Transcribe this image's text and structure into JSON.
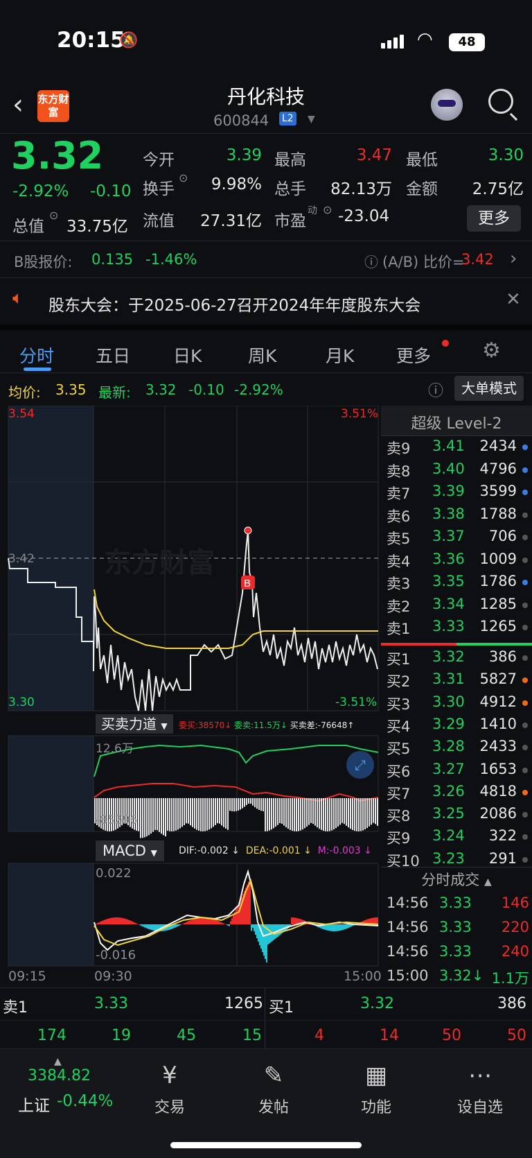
{
  "status_bar": {
    "time": "20:15",
    "battery": "48"
  },
  "header": {
    "logo_text": "东方财富",
    "stock_name": "丹化科技",
    "stock_code": "600844",
    "badge": "L2"
  },
  "quote": {
    "price": "3.32",
    "change_pct": "-2.92%",
    "change": "-0.10",
    "open_label": "今开",
    "open": "3.39",
    "high_label": "最高",
    "high": "3.47",
    "low_label": "最低",
    "low": "3.30",
    "turnover_label": "换手",
    "turnover": "9.98%",
    "volume_label": "总手",
    "volume": "82.13万",
    "amount_label": "金额",
    "amount": "2.75亿",
    "mktcap_label": "总值",
    "mktcap": "33.75亿",
    "float_label": "流值",
    "float": "27.31亿",
    "pe_label": "市盈",
    "pe_sup": "动",
    "pe": "-23.04",
    "more_label": "更多"
  },
  "bshare": {
    "label": "B股报价:",
    "price": "0.135",
    "pct": "-1.46%",
    "ratio_label": "(A/B) 比价=",
    "ratio": "3.42"
  },
  "notice": {
    "text": "股东大会：于2025-06-27召开2024年年度股东大会"
  },
  "tabs": [
    "分时",
    "五日",
    "日K",
    "周K",
    "月K",
    "更多"
  ],
  "avg": {
    "avg_label": "均价:",
    "avg": "3.35",
    "last_label": "最新:",
    "last": "3.32",
    "chg": "-0.10",
    "pct": "-2.92%",
    "mode_btn": "大单模式"
  },
  "chart": {
    "price_top": "3.54",
    "price_mid": "3.42",
    "price_bottom": "3.30",
    "pct_top": "3.51%",
    "pct_bottom": "-3.51%",
    "watermark": "东方财富",
    "b_marker": "B",
    "indicator1_label": "买卖力道",
    "weimai": "委买:38570",
    "weimai_arrow": "↓",
    "weimai2": "委卖:11.5万",
    "weimai2_arrow": "↓",
    "maimaicha": "买卖差:-76648",
    "maimaicha_arrow": "↑",
    "ind1_top": "12.6万",
    "ind1_bottom": "-85296",
    "indicator2_label": "MACD",
    "dif": "DIF:-0.002",
    "dif_arrow": "↓",
    "dea": "DEA:-0.001",
    "dea_arrow": "↓",
    "m": "M:-0.003",
    "m_arrow": "↓",
    "macd_top": "0.022",
    "macd_bottom": "-0.016",
    "time_start": "09:15",
    "time_open": "09:30",
    "time_end": "15:00"
  },
  "level2": {
    "title": "超级 Level-2",
    "sell": [
      {
        "label": "卖9",
        "price": "3.41",
        "vol": "2434",
        "dot": "#3b7fe0"
      },
      {
        "label": "卖8",
        "price": "3.40",
        "vol": "4796",
        "dot": "#3b7fe0"
      },
      {
        "label": "卖7",
        "price": "3.39",
        "vol": "3599",
        "dot": "#3b7fe0"
      },
      {
        "label": "卖6",
        "price": "3.38",
        "vol": "1788",
        "dot": "#555"
      },
      {
        "label": "卖5",
        "price": "3.37",
        "vol": "706",
        "dot": "#555"
      },
      {
        "label": "卖4",
        "price": "3.36",
        "vol": "1009",
        "dot": "#555"
      },
      {
        "label": "卖3",
        "price": "3.35",
        "vol": "1786",
        "dot": "#3b7fe0"
      },
      {
        "label": "卖2",
        "price": "3.34",
        "vol": "1285",
        "dot": "#555"
      },
      {
        "label": "卖1",
        "price": "3.33",
        "vol": "1265",
        "dot": "#555"
      }
    ],
    "buy": [
      {
        "label": "买1",
        "price": "3.32",
        "vol": "386",
        "dot": "#555"
      },
      {
        "label": "买2",
        "price": "3.31",
        "vol": "5827",
        "dot": "#f06a1c"
      },
      {
        "label": "买3",
        "price": "3.30",
        "vol": "4912",
        "dot": "#f06a1c"
      },
      {
        "label": "买4",
        "price": "3.29",
        "vol": "1410",
        "dot": "#555"
      },
      {
        "label": "买5",
        "price": "3.28",
        "vol": "2433",
        "dot": "#555"
      },
      {
        "label": "买6",
        "price": "3.27",
        "vol": "1653",
        "dot": "#555"
      },
      {
        "label": "买7",
        "price": "3.26",
        "vol": "4818",
        "dot": "#f06a1c"
      },
      {
        "label": "买8",
        "price": "3.25",
        "vol": "2086",
        "dot": "#555"
      },
      {
        "label": "买9",
        "price": "3.24",
        "vol": "322",
        "dot": "#555"
      },
      {
        "label": "买10",
        "price": "3.23",
        "vol": "291",
        "dot": "#555"
      }
    ],
    "trades_title": "分时成交",
    "trades": [
      {
        "time": "14:56",
        "price": "3.33",
        "vol": "146",
        "vcolor": "red"
      },
      {
        "time": "14:56",
        "price": "3.33",
        "vol": "220",
        "vcolor": "red"
      },
      {
        "time": "14:56",
        "price": "3.33",
        "vol": "240",
        "vcolor": "red"
      },
      {
        "time": "15:00",
        "price": "3.32↓",
        "vol": "1.1万",
        "vcolor": "green"
      }
    ]
  },
  "bottom_ob": {
    "sell_label": "卖1",
    "sell_price": "3.33",
    "sell_vol": "1265",
    "buy_label": "买1",
    "buy_price": "3.32",
    "buy_vol": "386",
    "sell_nums": [
      "174",
      "19",
      "45",
      "15"
    ],
    "buy_nums": [
      "4",
      "14",
      "50",
      "50"
    ]
  },
  "tabbar": {
    "index_value": "3384.82",
    "index_name": "上证",
    "index_pct": "-0.44%",
    "items": [
      "交易",
      "发帖",
      "功能",
      "设自选"
    ]
  }
}
